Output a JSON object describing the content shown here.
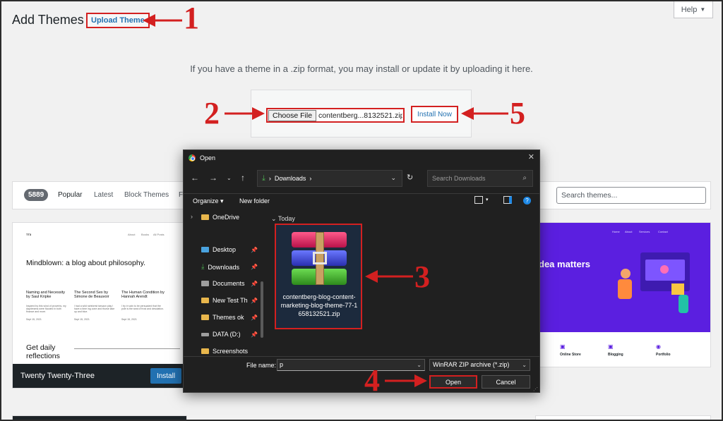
{
  "page": {
    "title": "Add Themes",
    "upload_theme": "Upload Theme",
    "help": "Help",
    "upload_info": "If you have a theme in a .zip format, you may install or update it by uploading it here.",
    "choose_file": "Choose File",
    "chosen_file": "contentberg...8132521.zip",
    "install_now": "Install Now"
  },
  "filter_bar": {
    "count": "5889",
    "tabs": [
      "Popular",
      "Latest",
      "Block Themes",
      "Fa"
    ],
    "search_placeholder": "Search themes..."
  },
  "theme_card_1": {
    "preview": {
      "brand": "TT3",
      "nav": [
        "About",
        "Books",
        "All Posts"
      ],
      "headline": "Mindblown: a blog about philosophy.",
      "posts": [
        {
          "title": "Naming and Necessity by Saul Kripke",
          "excerpt": "Inspired by this wind of proverbs, my daydreams were flooded in both finance and more.",
          "date": "Sept 15, 2021"
        },
        {
          "title": "The Second Sex by Simone de Beauvoir",
          "excerpt": "I had a wild rainforest tarsaon play I have a time ing cone and thurse lake up and blue.",
          "date": "Sept 15, 2021"
        },
        {
          "title": "The Human Condition by Hannah Arendt",
          "excerpt": "I try in vain to be persuaded that the pole is the seat of frost and desolation.",
          "date": "Sept 15, 2021"
        }
      ],
      "cta": "Get daily reflections"
    },
    "name": "Twenty Twenty-Three",
    "install": "Install"
  },
  "theme_card_2": {
    "nav": [
      "Home",
      "About",
      "Services",
      "Contact"
    ],
    "headline": "dea matters",
    "services": [
      "Online Store",
      "Blogging",
      "Portfolio"
    ]
  },
  "dialog": {
    "title": "Open",
    "close": "✕",
    "address": "Downloads",
    "search_placeholder": "Search Downloads",
    "organize": "Organize",
    "new_folder": "New folder",
    "help": "?",
    "nav_items": [
      {
        "label": "OneDrive",
        "icon": "folder-icon"
      },
      {
        "label": "Desktop",
        "icon": "desktop-icon"
      },
      {
        "label": "Downloads",
        "icon": "download-icon"
      },
      {
        "label": "Documents",
        "icon": "documents-icon"
      },
      {
        "label": "New Test Th",
        "icon": "folder-icon"
      },
      {
        "label": "Themes ok",
        "icon": "folder-icon"
      },
      {
        "label": "DATA (D:)",
        "icon": "drive-icon"
      },
      {
        "label": "Screenshots",
        "icon": "folder-icon"
      }
    ],
    "group": "Today",
    "file": "contentberg-blog-content-marketing-blog-theme-77-1658132521.zip",
    "file_name_label": "File name:",
    "file_name_value": "p",
    "file_type": "WinRAR ZIP archive (*.zip)",
    "open": "Open",
    "cancel": "Cancel"
  },
  "annotations": {
    "step1": "1",
    "step2": "2",
    "step3": "3",
    "step4": "4",
    "step5": "5",
    "color": "#d32020"
  }
}
